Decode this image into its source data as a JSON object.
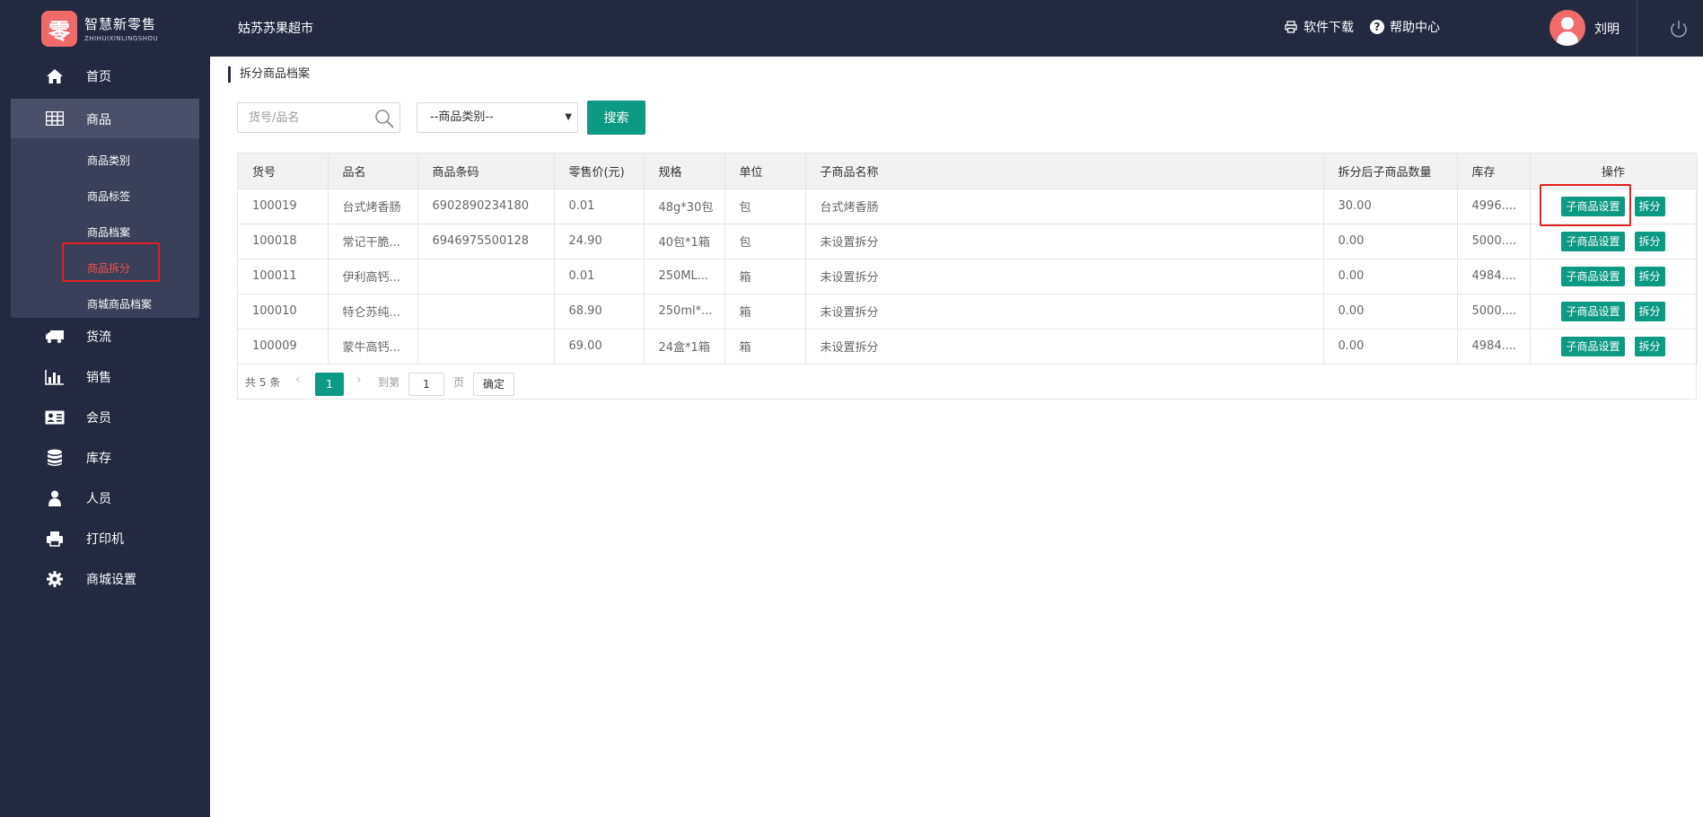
{
  "header": {
    "logo_mark": "零",
    "logo_cn": "智慧新零售",
    "logo_en": "ZHIHUIXINLINGSHOU",
    "store_name": "姑苏苏果超市",
    "download_label": "软件下载",
    "help_label": "帮助中心",
    "user_name": "刘明"
  },
  "sidebar": {
    "items": [
      {
        "label": "首页",
        "icon": "home-icon"
      },
      {
        "label": "商品",
        "icon": "grid-icon"
      },
      {
        "label": "货流",
        "icon": "truck-icon"
      },
      {
        "label": "销售",
        "icon": "bar-chart-icon"
      },
      {
        "label": "会员",
        "icon": "id-card-icon"
      },
      {
        "label": "库存",
        "icon": "database-icon"
      },
      {
        "label": "人员",
        "icon": "user-icon"
      },
      {
        "label": "打印机",
        "icon": "printer-icon"
      },
      {
        "label": "商城设置",
        "icon": "gear-icon"
      }
    ],
    "sub_items": [
      "商品类别",
      "商品标签",
      "商品档案",
      "商品拆分",
      "商城商品档案"
    ],
    "active_sub": "商品拆分"
  },
  "main": {
    "breadcrumb": "拆分商品档案",
    "search_placeholder": "货号/品名",
    "category_select": "--商品类别--",
    "search_button": "搜索",
    "columns": [
      "货号",
      "品名",
      "商品条码",
      "零售价(元)",
      "规格",
      "单位",
      "子商品名称",
      "拆分后子商品数量",
      "库存",
      "操作"
    ],
    "rows": [
      [
        "100019",
        "台式烤香肠",
        "6902890234180",
        "0.01",
        "48g*30包",
        "包",
        "台式烤香肠",
        "30.00",
        "4996...."
      ],
      [
        "100018",
        "常记干脆...",
        "6946975500128",
        "24.90",
        "40包*1箱",
        "包",
        "未设置拆分",
        "0.00",
        "5000...."
      ],
      [
        "100011",
        "伊利高钙...",
        "",
        "0.01",
        "250ML...",
        "箱",
        "未设置拆分",
        "0.00",
        "4984...."
      ],
      [
        "100010",
        "特仑苏纯...",
        "",
        "68.90",
        "250ml*...",
        "箱",
        "未设置拆分",
        "0.00",
        "5000...."
      ],
      [
        "100009",
        "蒙牛高钙...",
        "",
        "69.00",
        "24盒*1箱",
        "箱",
        "未设置拆分",
        "0.00",
        "4984...."
      ]
    ],
    "op_sub_label": "子商品设置",
    "op_split_label": "拆分",
    "pager": {
      "total": "共 5 条",
      "current": "1",
      "goto_label": "到第",
      "goto_value": "1",
      "unit": "页",
      "confirm": "确定"
    }
  },
  "colors": {
    "sidebar_bg": "#232a40",
    "accent": "#0d9a82",
    "highlight": "#e02020"
  }
}
